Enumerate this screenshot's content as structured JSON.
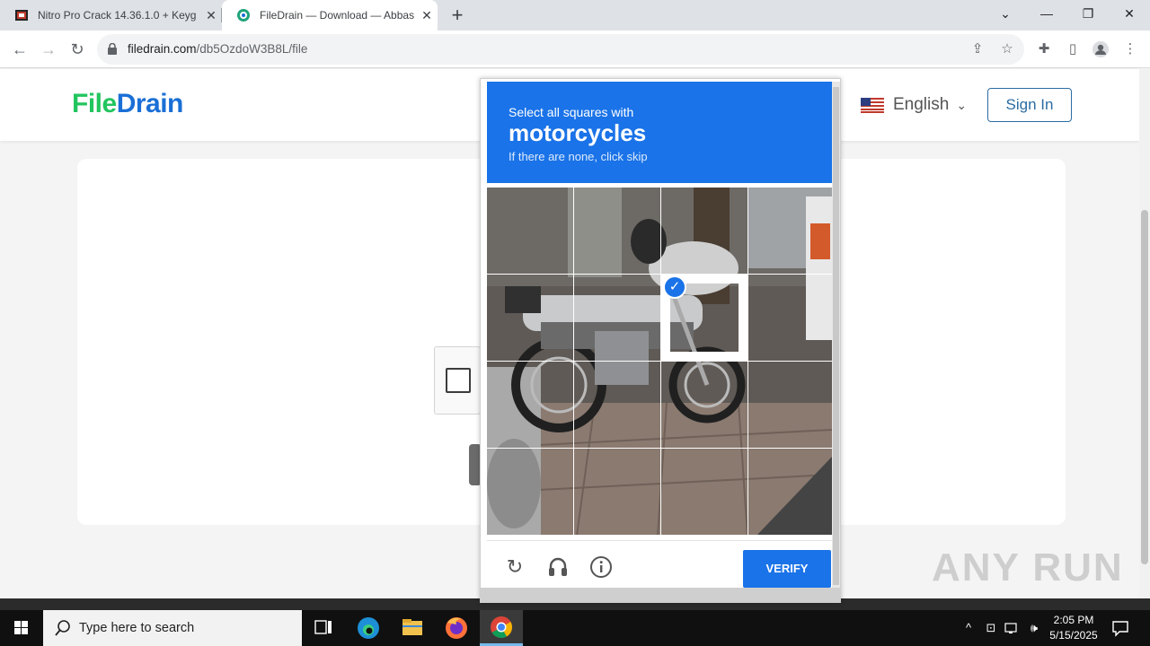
{
  "browser": {
    "tabs": [
      {
        "title": "Nitro Pro Crack 14.36.1.0 + Keyg",
        "active": false
      },
      {
        "title": "FileDrain — Download — Abbas",
        "active": true
      }
    ],
    "url_domain": "filedrain.com",
    "url_path": "/db5OzdoW3B8L/file"
  },
  "site": {
    "logo_part1": "File",
    "logo_part2": "Drain",
    "language": "English",
    "signin_label": "Sign In"
  },
  "captcha": {
    "instruction_line1": "Select all squares with",
    "target_word": "motorcycles",
    "instruction_line3": "If there are none, click skip",
    "verify_label": "VERIFY",
    "selected_tiles": [
      6
    ],
    "colors": {
      "header": "#1a73e8",
      "verify": "#1a73e8"
    }
  },
  "watermark": "ANY RUN",
  "taskbar": {
    "search_placeholder": "Type here to search",
    "time": "2:05 PM",
    "date": "5/15/2025"
  }
}
